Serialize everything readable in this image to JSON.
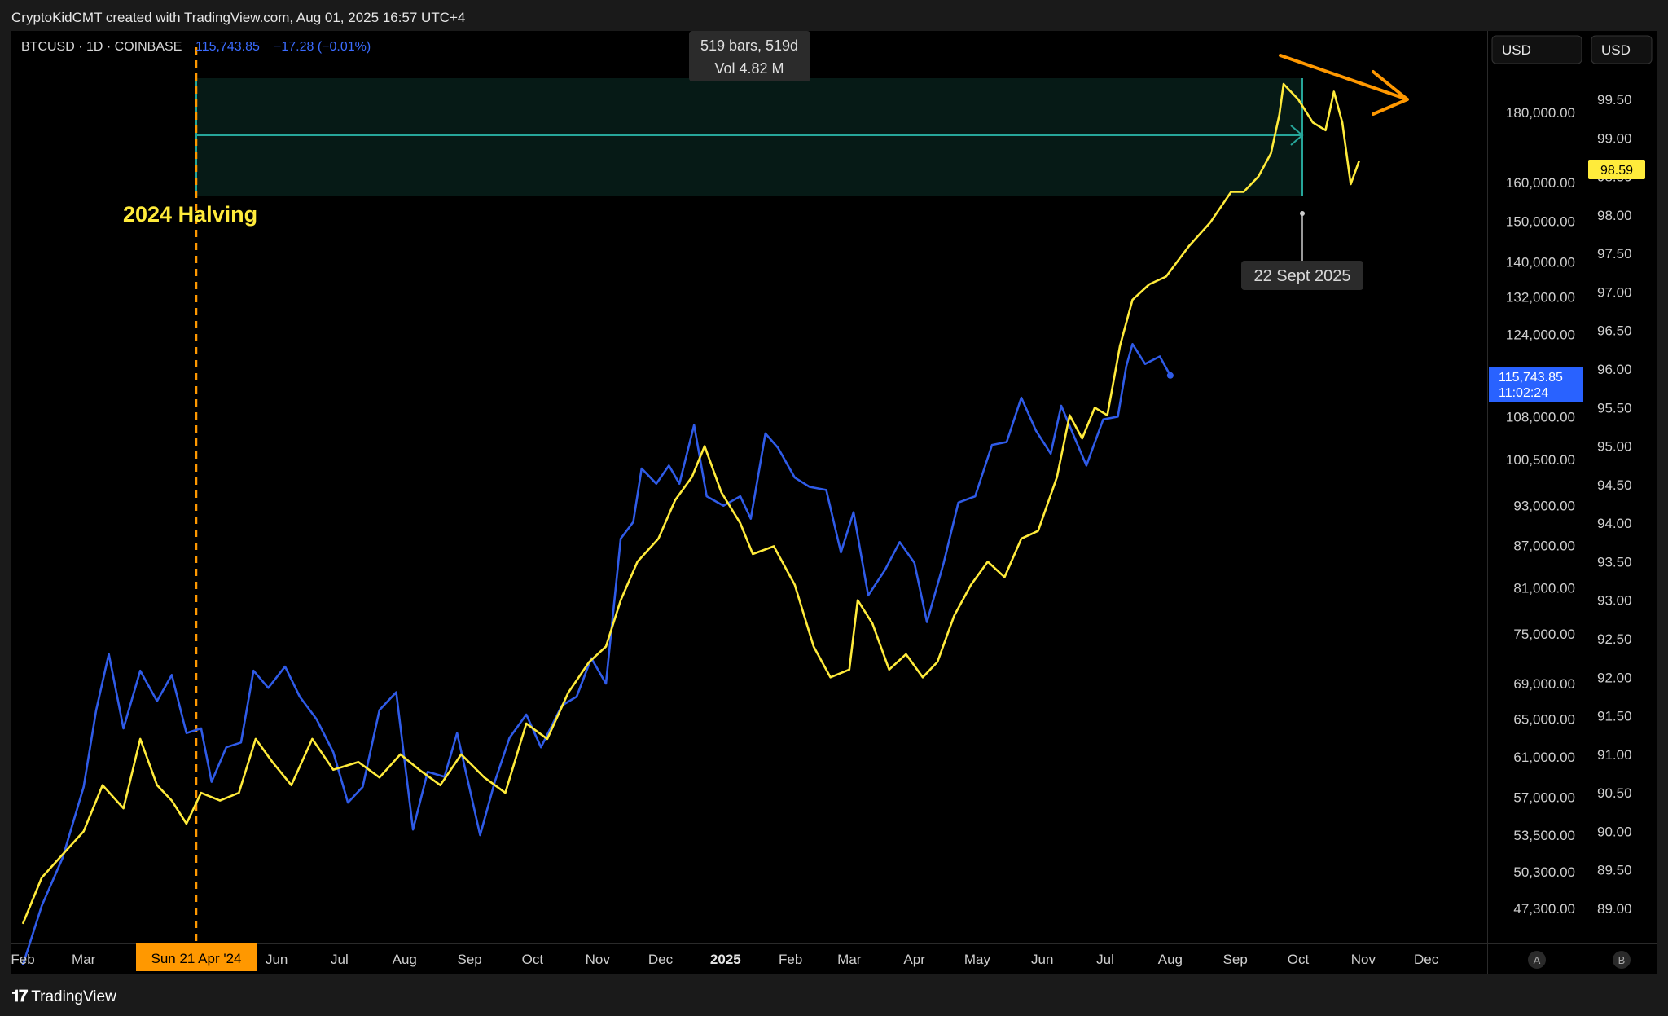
{
  "header": {
    "credit": "CryptoKidCMT created with TradingView.com, Aug 01, 2025 16:57 UTC+4"
  },
  "legend": {
    "symbol": "BTCUSD · 1D · COINBASE",
    "price": "115,743.85",
    "change": "−17.28 (−0.01%)"
  },
  "measure": {
    "bars": "519 bars, 519d",
    "vol": "Vol 4.82 M"
  },
  "halving_label": "2024 Halving",
  "sept_label": "22 Sept 2025",
  "date_badge": "Sun 21 Apr '24",
  "price_tag": {
    "price": "115,743.85",
    "time": "11:02:24"
  },
  "b_tag": "98.59",
  "currency_a": "USD",
  "currency_b": "USD",
  "scale_a_label": "A",
  "scale_b_label": "B",
  "footer": {
    "brand": "TradingView"
  },
  "colors": {
    "btc": "#2f5be8",
    "yellow": "#ffeb3b",
    "orange": "#ff9800",
    "teal": "#26a69a",
    "axis_text": "#cfcfcf"
  },
  "chart_data": {
    "type": "line",
    "x_tick_labels": [
      "Feb",
      "Mar",
      "Apr",
      "May",
      "Jun",
      "Jul",
      "Aug",
      "Sep",
      "Oct",
      "Nov",
      "Dec",
      "2025",
      "Feb",
      "Mar",
      "Apr",
      "May",
      "Jun",
      "Jul",
      "Aug",
      "Sep",
      "Oct",
      "Nov",
      "Dec"
    ],
    "x_bold_label": "2025",
    "y_left_scale": "log",
    "y_left_ticks": [
      180000,
      160000,
      150000,
      140000,
      132000,
      124000,
      108000,
      100500,
      93000,
      87000,
      81000,
      75000,
      69000,
      65000,
      61000,
      57000,
      53500,
      50300,
      47300
    ],
    "y_right_ticks": [
      99.5,
      99.0,
      98.5,
      98.0,
      97.5,
      97.0,
      96.5,
      96.0,
      95.5,
      95.0,
      94.5,
      94.0,
      93.5,
      93.0,
      92.5,
      92.0,
      91.5,
      91.0,
      90.5,
      90.0,
      89.5,
      89.0
    ],
    "series": [
      {
        "name": "BTCUSD",
        "axis": "left",
        "points": [
          [
            "2024-02-01",
            43000
          ],
          [
            "2024-02-10",
            47500
          ],
          [
            "2024-02-20",
            51500
          ],
          [
            "2024-03-01",
            58000
          ],
          [
            "2024-03-07",
            66000
          ],
          [
            "2024-03-13",
            72500
          ],
          [
            "2024-03-20",
            64000
          ],
          [
            "2024-03-28",
            70500
          ],
          [
            "2024-04-05",
            67000
          ],
          [
            "2024-04-12",
            70000
          ],
          [
            "2024-04-19",
            63500
          ],
          [
            "2024-04-26",
            64000
          ],
          [
            "2024-05-01",
            58500
          ],
          [
            "2024-05-08",
            62000
          ],
          [
            "2024-05-15",
            62500
          ],
          [
            "2024-05-21",
            70500
          ],
          [
            "2024-05-28",
            68500
          ],
          [
            "2024-06-05",
            71000
          ],
          [
            "2024-06-12",
            67500
          ],
          [
            "2024-06-20",
            65000
          ],
          [
            "2024-06-28",
            61500
          ],
          [
            "2024-07-05",
            56500
          ],
          [
            "2024-07-12",
            58000
          ],
          [
            "2024-07-20",
            66000
          ],
          [
            "2024-07-28",
            68000
          ],
          [
            "2024-08-05",
            54000
          ],
          [
            "2024-08-12",
            59500
          ],
          [
            "2024-08-20",
            59000
          ],
          [
            "2024-08-26",
            63500
          ],
          [
            "2024-09-06",
            53500
          ],
          [
            "2024-09-13",
            58500
          ],
          [
            "2024-09-20",
            63000
          ],
          [
            "2024-09-28",
            65500
          ],
          [
            "2024-10-05",
            62000
          ],
          [
            "2024-10-15",
            66500
          ],
          [
            "2024-10-22",
            67500
          ],
          [
            "2024-10-29",
            72000
          ],
          [
            "2024-11-05",
            69000
          ],
          [
            "2024-11-12",
            88000
          ],
          [
            "2024-11-18",
            90500
          ],
          [
            "2024-11-22",
            99000
          ],
          [
            "2024-11-29",
            96500
          ],
          [
            "2024-12-05",
            99500
          ],
          [
            "2024-12-10",
            96500
          ],
          [
            "2024-12-17",
            106500
          ],
          [
            "2024-12-23",
            94500
          ],
          [
            "2024-12-31",
            93000
          ],
          [
            "2025-01-08",
            94500
          ],
          [
            "2025-01-13",
            91000
          ],
          [
            "2025-01-20",
            105000
          ],
          [
            "2025-01-26",
            102500
          ],
          [
            "2025-02-03",
            97500
          ],
          [
            "2025-02-10",
            96000
          ],
          [
            "2025-02-18",
            95500
          ],
          [
            "2025-02-25",
            86000
          ],
          [
            "2025-03-03",
            92000
          ],
          [
            "2025-03-10",
            80000
          ],
          [
            "2025-03-18",
            83500
          ],
          [
            "2025-03-25",
            87500
          ],
          [
            "2025-04-01",
            84500
          ],
          [
            "2025-04-07",
            76500
          ],
          [
            "2025-04-15",
            84500
          ],
          [
            "2025-04-22",
            93500
          ],
          [
            "2025-04-30",
            94500
          ],
          [
            "2025-05-08",
            103000
          ],
          [
            "2025-05-15",
            103500
          ],
          [
            "2025-05-22",
            111500
          ],
          [
            "2025-05-29",
            105500
          ],
          [
            "2025-06-05",
            101500
          ],
          [
            "2025-06-10",
            110000
          ],
          [
            "2025-06-15",
            105500
          ],
          [
            "2025-06-22",
            99500
          ],
          [
            "2025-06-30",
            107500
          ],
          [
            "2025-07-07",
            108000
          ],
          [
            "2025-07-11",
            117500
          ],
          [
            "2025-07-14",
            122000
          ],
          [
            "2025-07-20",
            118000
          ],
          [
            "2025-07-27",
            119500
          ],
          [
            "2025-08-01",
            115743.85
          ]
        ]
      },
      {
        "name": "",
        "axis": "right",
        "points": [
          [
            "2024-02-01",
            88.8
          ],
          [
            "2024-02-10",
            89.4
          ],
          [
            "2024-02-20",
            89.7
          ],
          [
            "2024-03-01",
            90.0
          ],
          [
            "2024-03-10",
            90.6
          ],
          [
            "2024-03-20",
            90.3
          ],
          [
            "2024-03-28",
            91.2
          ],
          [
            "2024-04-05",
            90.6
          ],
          [
            "2024-04-12",
            90.4
          ],
          [
            "2024-04-19",
            90.1
          ],
          [
            "2024-04-26",
            90.5
          ],
          [
            "2024-05-05",
            90.4
          ],
          [
            "2024-05-14",
            90.5
          ],
          [
            "2024-05-22",
            91.2
          ],
          [
            "2024-05-30",
            90.9
          ],
          [
            "2024-06-08",
            90.6
          ],
          [
            "2024-06-18",
            91.2
          ],
          [
            "2024-06-28",
            90.8
          ],
          [
            "2024-07-10",
            90.9
          ],
          [
            "2024-07-20",
            90.7
          ],
          [
            "2024-07-30",
            91.0
          ],
          [
            "2024-08-08",
            90.8
          ],
          [
            "2024-08-18",
            90.6
          ],
          [
            "2024-08-28",
            91.0
          ],
          [
            "2024-09-08",
            90.7
          ],
          [
            "2024-09-18",
            90.5
          ],
          [
            "2024-09-28",
            91.4
          ],
          [
            "2024-10-08",
            91.2
          ],
          [
            "2024-10-18",
            91.8
          ],
          [
            "2024-10-28",
            92.2
          ],
          [
            "2024-11-05",
            92.4
          ],
          [
            "2024-11-12",
            93.0
          ],
          [
            "2024-11-20",
            93.5
          ],
          [
            "2024-11-30",
            93.8
          ],
          [
            "2024-12-08",
            94.3
          ],
          [
            "2024-12-16",
            94.6
          ],
          [
            "2024-12-22",
            95.0
          ],
          [
            "2024-12-30",
            94.4
          ],
          [
            "2025-01-08",
            94.0
          ],
          [
            "2025-01-14",
            93.6
          ],
          [
            "2025-01-24",
            93.7
          ],
          [
            "2025-02-03",
            93.2
          ],
          [
            "2025-02-12",
            92.4
          ],
          [
            "2025-02-20",
            92.0
          ],
          [
            "2025-03-01",
            92.1
          ],
          [
            "2025-03-05",
            93.0
          ],
          [
            "2025-03-12",
            92.7
          ],
          [
            "2025-03-20",
            92.1
          ],
          [
            "2025-03-28",
            92.3
          ],
          [
            "2025-04-05",
            92.0
          ],
          [
            "2025-04-12",
            92.2
          ],
          [
            "2025-04-20",
            92.8
          ],
          [
            "2025-04-28",
            93.2
          ],
          [
            "2025-05-06",
            93.5
          ],
          [
            "2025-05-14",
            93.3
          ],
          [
            "2025-05-22",
            93.8
          ],
          [
            "2025-05-30",
            93.9
          ],
          [
            "2025-06-08",
            94.6
          ],
          [
            "2025-06-14",
            95.4
          ],
          [
            "2025-06-20",
            95.1
          ],
          [
            "2025-06-26",
            95.5
          ],
          [
            "2025-07-02",
            95.4
          ],
          [
            "2025-07-08",
            96.3
          ],
          [
            "2025-07-14",
            96.9
          ],
          [
            "2025-07-22",
            97.1
          ],
          [
            "2025-07-30",
            97.2
          ],
          [
            "2025-08-10",
            97.6
          ],
          [
            "2025-08-20",
            97.9
          ],
          [
            "2025-08-30",
            98.3
          ],
          [
            "2025-09-05",
            98.3
          ],
          [
            "2025-09-12",
            98.5
          ],
          [
            "2025-09-18",
            98.8
          ],
          [
            "2025-09-22",
            99.3
          ],
          [
            "2025-09-24",
            99.7
          ],
          [
            "2025-10-01",
            99.5
          ],
          [
            "2025-10-08",
            99.2
          ],
          [
            "2025-10-14",
            99.1
          ],
          [
            "2025-10-18",
            99.6
          ],
          [
            "2025-10-22",
            99.2
          ],
          [
            "2025-10-26",
            98.4
          ],
          [
            "2025-10-30",
            98.7
          ]
        ]
      }
    ],
    "annotations": {
      "halving_date": "2024-04-21",
      "measure_range": [
        "2024-04-21",
        "2025-09-22"
      ]
    }
  }
}
